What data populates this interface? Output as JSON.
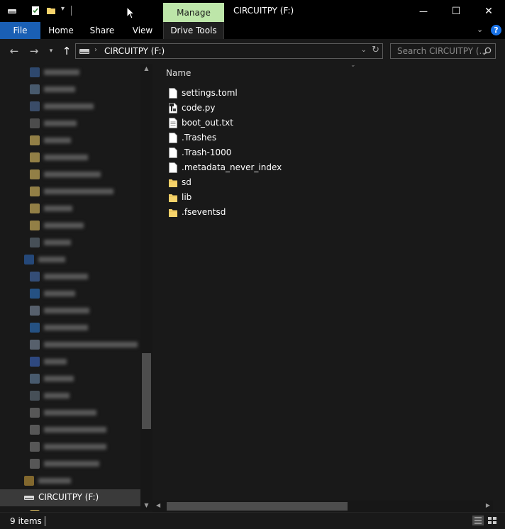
{
  "window": {
    "title": "CIRCUITPY (F:)",
    "contextual_tab_group": "Manage",
    "minimize": "—",
    "maximize": "☐",
    "close": "✕"
  },
  "ribbon": {
    "tabs": [
      "File",
      "Home",
      "Share",
      "View",
      "Drive Tools"
    ],
    "help": "?"
  },
  "address": {
    "path": "CIRCUITPY (F:)",
    "search_placeholder": "Search CIRCUITPY (..."
  },
  "navigation": {
    "selected_item": "CIRCUITPY (F:)"
  },
  "file_list": {
    "column_header": "Name",
    "items": [
      {
        "name": "settings.toml",
        "icon": "document-icon"
      },
      {
        "name": "code.py",
        "icon": "python-file-icon"
      },
      {
        "name": "boot_out.txt",
        "icon": "text-file-icon"
      },
      {
        "name": ".Trashes",
        "icon": "document-icon"
      },
      {
        "name": ".Trash-1000",
        "icon": "document-icon"
      },
      {
        "name": ".metadata_never_index",
        "icon": "document-icon"
      },
      {
        "name": "sd",
        "icon": "folder-icon"
      },
      {
        "name": "lib",
        "icon": "folder-icon"
      },
      {
        "name": ".fseventsd",
        "icon": "folder-icon"
      }
    ]
  },
  "status": {
    "item_count": "9 items"
  },
  "colors": {
    "manage_tab": "#bde6a9",
    "file_tab": "#1a5fb4",
    "folder": "#f6d36b",
    "selection": "#3a3a3a",
    "background": "#191919"
  }
}
